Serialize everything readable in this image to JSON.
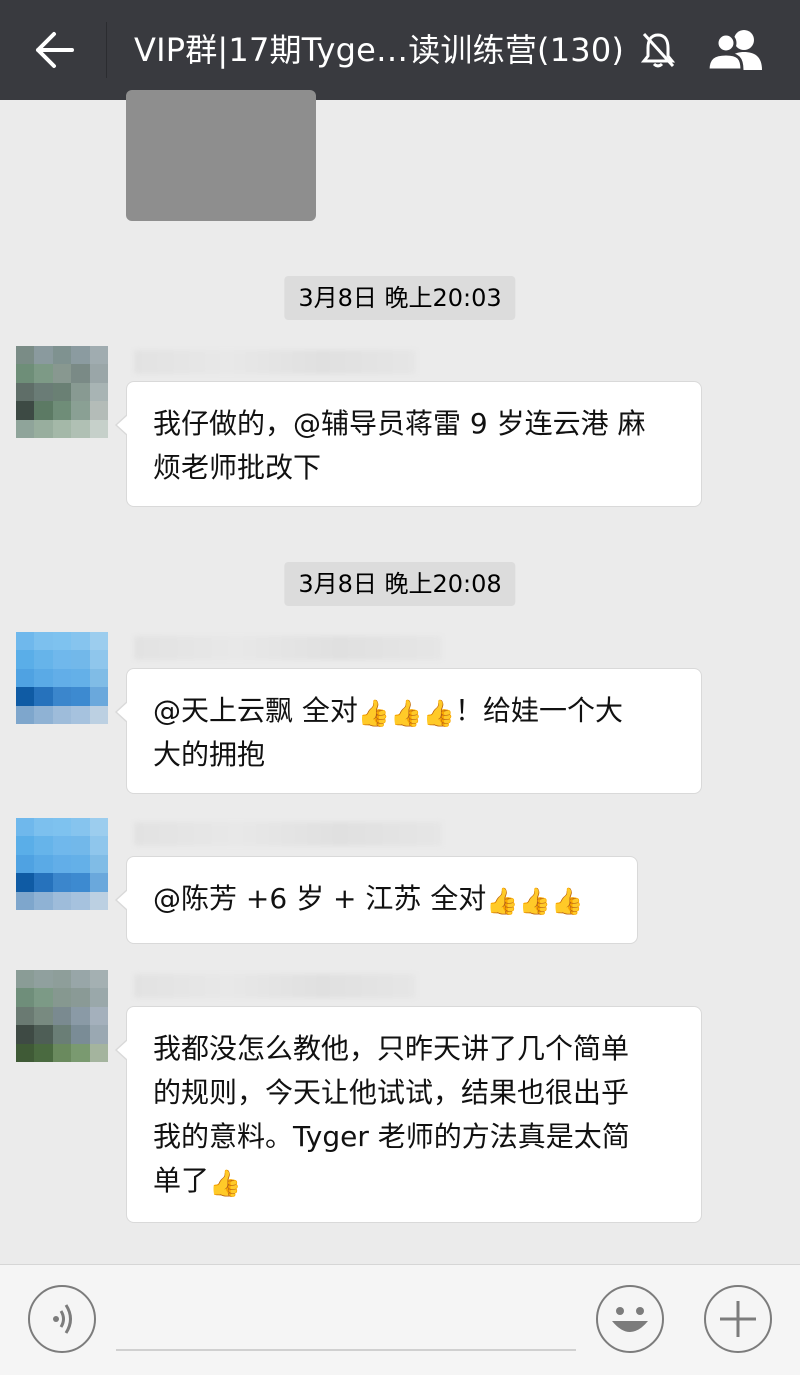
{
  "header": {
    "title": "VIP群|17期Tyge…读训练营(130)",
    "back_icon": "arrow-left-icon",
    "mute_icon": "bell-muted-icon",
    "members_icon": "group-members-icon"
  },
  "messages": [
    {
      "timestamp": "3月8日 晚上20:03",
      "text_line1": "我仔做的，@辅导员蒋雷 9 岁连云港  麻",
      "text_line2": "烦老师批改下"
    },
    {
      "timestamp": "3月8日 晚上20:08",
      "text_line1_a": "@天上云飘  全对",
      "text_line1_b": "！给娃一个大",
      "text_line2": "大的拥抱"
    },
    {
      "text_a": "@陈芳 +6 岁 + 江苏  全对"
    },
    {
      "text_line1": "我都没怎么教他，只昨天讲了几个简单",
      "text_line2": "的规则，今天让他试试，结果也很出乎",
      "text_line3": "我的意料。Tyger 老师的方法真是太简",
      "text_line4": "单了"
    }
  ],
  "emoji": {
    "thumb": "👍"
  },
  "bottom": {
    "voice_icon": "voice-input-icon",
    "emoji_icon": "emoji-smiley-icon",
    "plus_icon": "plus-icon"
  },
  "colors": {
    "topbar": "#393a3f",
    "background": "#ebebeb"
  }
}
